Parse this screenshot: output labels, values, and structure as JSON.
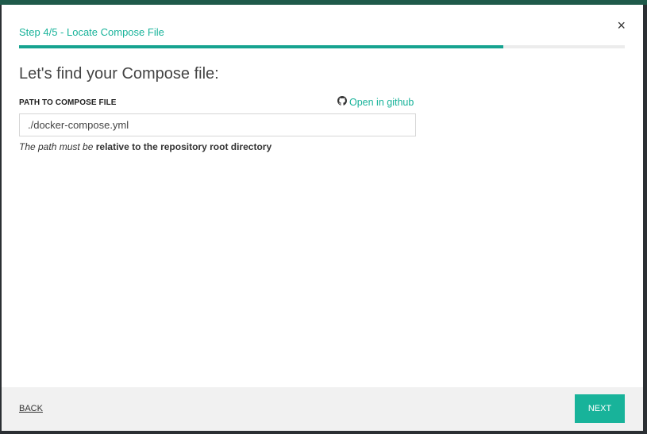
{
  "wizard": {
    "step_title": "Step 4/5 - Locate Compose File",
    "progress": 0.8,
    "close_label": "×"
  },
  "main": {
    "heading": "Let's find your Compose file:",
    "field_label": "PATH TO COMPOSE FILE",
    "github_link": "Open in github",
    "path_value": "./docker-compose.yml",
    "hint_prefix": "The path must be",
    "hint_bold": "relative to the repository root directory"
  },
  "footer": {
    "back_label": "BACK",
    "next_label": "NEXT"
  },
  "colors": {
    "accent": "#18b39a",
    "progress_fill": "#16a390",
    "footer_bg": "#f1f1f1"
  },
  "icons": {
    "github": "github-icon",
    "close": "close-icon"
  }
}
